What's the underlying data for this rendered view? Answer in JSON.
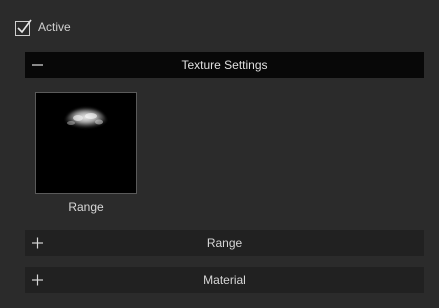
{
  "active": {
    "label": "Active",
    "checked": true
  },
  "sections": {
    "texture_settings": {
      "title": "Texture Settings",
      "state": "expanded",
      "toggle_symbol": "−"
    },
    "range": {
      "title": "Range",
      "state": "collapsed",
      "toggle_symbol": "+"
    },
    "material": {
      "title": "Material",
      "state": "collapsed",
      "toggle_symbol": "+"
    }
  },
  "texture_slot": {
    "label": "Range"
  },
  "icons": {
    "checkbox": "check-icon",
    "collapse": "minus-icon",
    "expand": "plus-icon"
  },
  "colors": {
    "background": "#2b2b2b",
    "header_active": "#080808",
    "header_collapsed": "#212121",
    "text": "#d8d8d8"
  }
}
